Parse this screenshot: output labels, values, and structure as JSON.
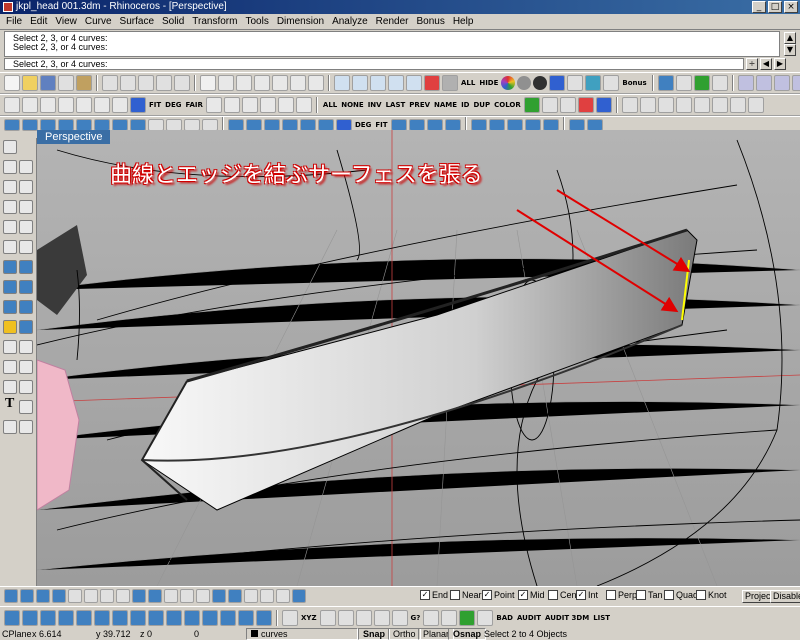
{
  "window": {
    "title": "jkpl_head 001.3dm - Rhinoceros - [Perspective]",
    "minimize_label": "_",
    "maximize_label": "□",
    "close_label": "×"
  },
  "menu": [
    "File",
    "Edit",
    "View",
    "Curve",
    "Surface",
    "Solid",
    "Transform",
    "Tools",
    "Dimension",
    "Analyze",
    "Render",
    "Bonus",
    "Help"
  ],
  "command": {
    "history": [
      "Select 2, 3, or 4 curves:",
      "Select 2, 3, or 4 curves:"
    ],
    "prompt": "Select 2, 3, or 4 curves:"
  },
  "toolbars": {
    "row1_labels": [
      "ALL",
      "HIDE",
      "Bonus"
    ],
    "row2_labels": [
      "FIT",
      "DEG",
      "FAIR",
      "ALL",
      "NONE",
      "INV",
      "LAST",
      "PREV",
      "NAME",
      "ID",
      "DUP",
      "COLOR"
    ],
    "row3_labels": [
      "DEG",
      "FIT"
    ],
    "bottom1_labels": [],
    "bottom2_labels": [
      "XYZ",
      "G?",
      "BAD",
      "AUDIT",
      "AUDIT 3DM",
      "LIST"
    ],
    "accent_colors": [
      "#e03030",
      "#f0c020",
      "#30a030",
      "#3060d0",
      "#a040c0",
      "#20a0c0"
    ]
  },
  "left_toolbar": {
    "text_tool_label": "T"
  },
  "viewport": {
    "name": "Perspective",
    "annotation": "曲線とエッジを結ぶサーフェスを張る",
    "background": "#a9a9a9",
    "arrow_color": "#e00000",
    "edge_highlight": "#ffff00"
  },
  "osnap": {
    "items": [
      {
        "label": "End",
        "checked": true
      },
      {
        "label": "Near",
        "checked": false
      },
      {
        "label": "Point",
        "checked": true
      },
      {
        "label": "Mid",
        "checked": true
      },
      {
        "label": "Cen",
        "checked": false
      },
      {
        "label": "Int",
        "checked": true
      },
      {
        "label": "Perp",
        "checked": false
      },
      {
        "label": "Tan",
        "checked": false
      },
      {
        "label": "Quad",
        "checked": false
      },
      {
        "label": "Knot",
        "checked": false
      }
    ],
    "project_label": "Project",
    "disable_label": "Disable"
  },
  "status": {
    "cplane": "CPlane",
    "x": "x 6.614",
    "y": "y 39.712",
    "z": "z 0",
    "extra": "0",
    "layer": "curves",
    "snap": "Snap",
    "ortho": "Ortho",
    "planar": "Planar",
    "osnap": "Osnap",
    "message": "Select 2 to 4 Objects"
  }
}
